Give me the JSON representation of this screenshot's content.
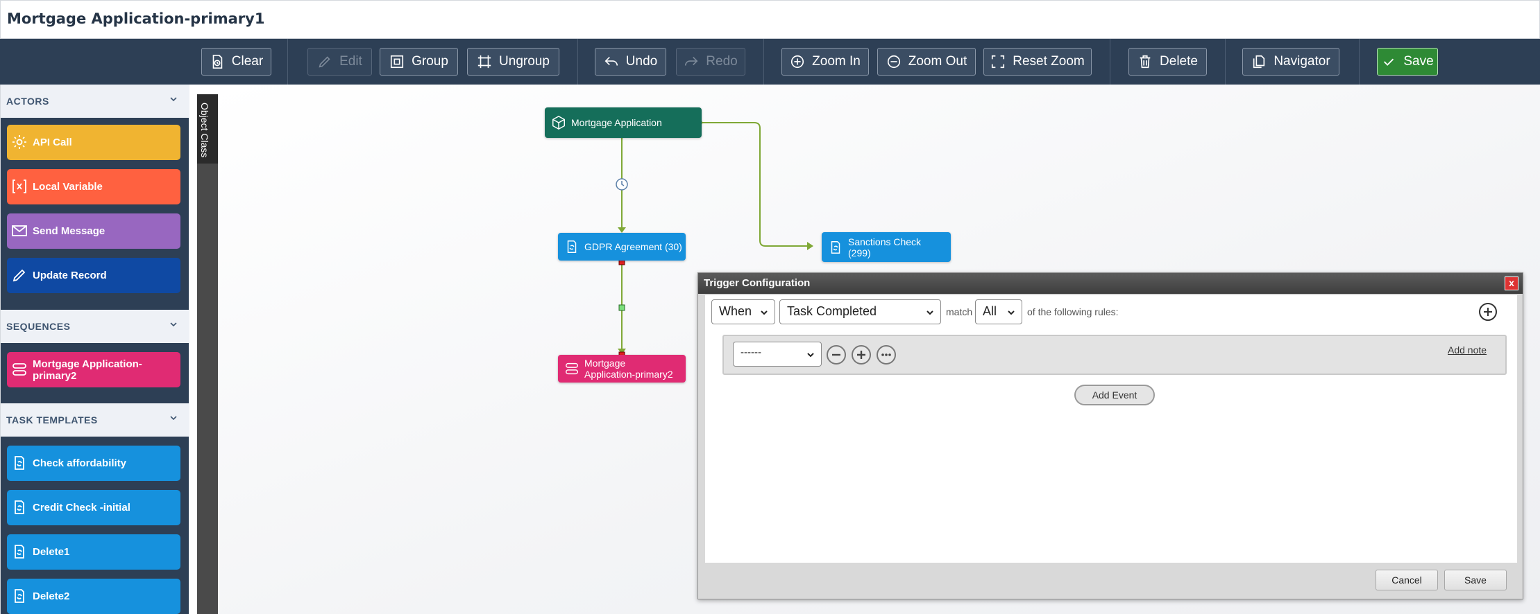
{
  "app": {
    "title": "Mortgage Application-primary1"
  },
  "toolbar": {
    "clear": "Clear",
    "edit": "Edit",
    "group": "Group",
    "ungroup": "Ungroup",
    "undo": "Undo",
    "redo": "Redo",
    "zoom_in": "Zoom In",
    "zoom_out": "Zoom Out",
    "reset_zoom": "Reset Zoom",
    "delete": "Delete",
    "navigator": "Navigator",
    "save": "Save"
  },
  "sidebar": {
    "actors": {
      "title": "ACTORS",
      "items": [
        "API Call",
        "Local Variable",
        "Send Message",
        "Update Record"
      ]
    },
    "sequences": {
      "title": "SEQUENCES",
      "items": [
        "Mortgage Application-primary2"
      ]
    },
    "task_templates": {
      "title": "TASK TEMPLATES",
      "items": [
        "Check affordability",
        "Credit Check -initial",
        "Delete1",
        "Delete2"
      ]
    }
  },
  "object_class": {
    "label": "Object Class"
  },
  "canvas": {
    "nodes": {
      "start": "Mortgage Application",
      "gdpr": "GDPR Agreement (30)",
      "sanctions_line1": "Sanctions Check",
      "sanctions_line2": "(299)",
      "seq_line1": "Mortgage",
      "seq_line2": "Application-primary2"
    }
  },
  "trigger_dialog": {
    "title": "Trigger Configuration",
    "close": "x",
    "when_select": "When",
    "event_select": "Task Completed",
    "match_label": "match",
    "match_select": "All",
    "rules_label": "of the following rules:",
    "rule_select": "------",
    "add_note": "Add note",
    "add_event": "Add Event",
    "cancel": "Cancel",
    "save": "Save"
  },
  "colors": {
    "toolbar_bg": "#2d3f55",
    "save_green": "#2e8a35",
    "api_call": "#f0b431",
    "local_variable": "#ff6140",
    "send_message": "#9867c0",
    "update_record": "#0f49a3",
    "sequence_pink": "#e02b73",
    "task_blue": "#1691dd",
    "start_green": "#156e5a",
    "edge_green": "#7fa836"
  }
}
